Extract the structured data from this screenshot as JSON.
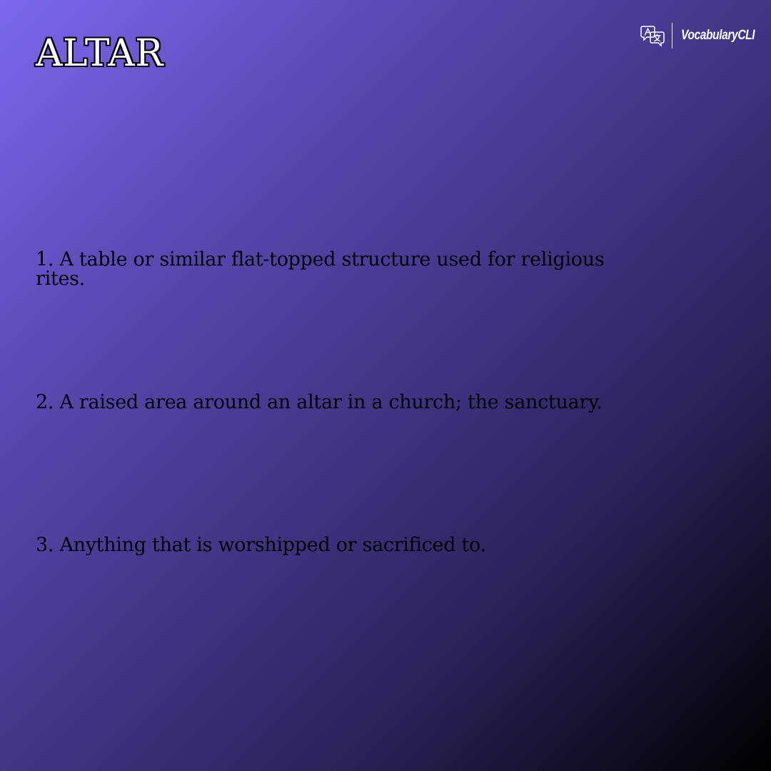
{
  "word": "ALTAR",
  "brand": {
    "icon": "translate-icon",
    "name": "VocabularyCLI"
  },
  "definitions": [
    "1. A table or similar flat-topped structure used for religious rites.",
    "2. A raised area around an altar in a church; the sanctuary.",
    "3. Anything that is worshipped or sacrificed to."
  ]
}
